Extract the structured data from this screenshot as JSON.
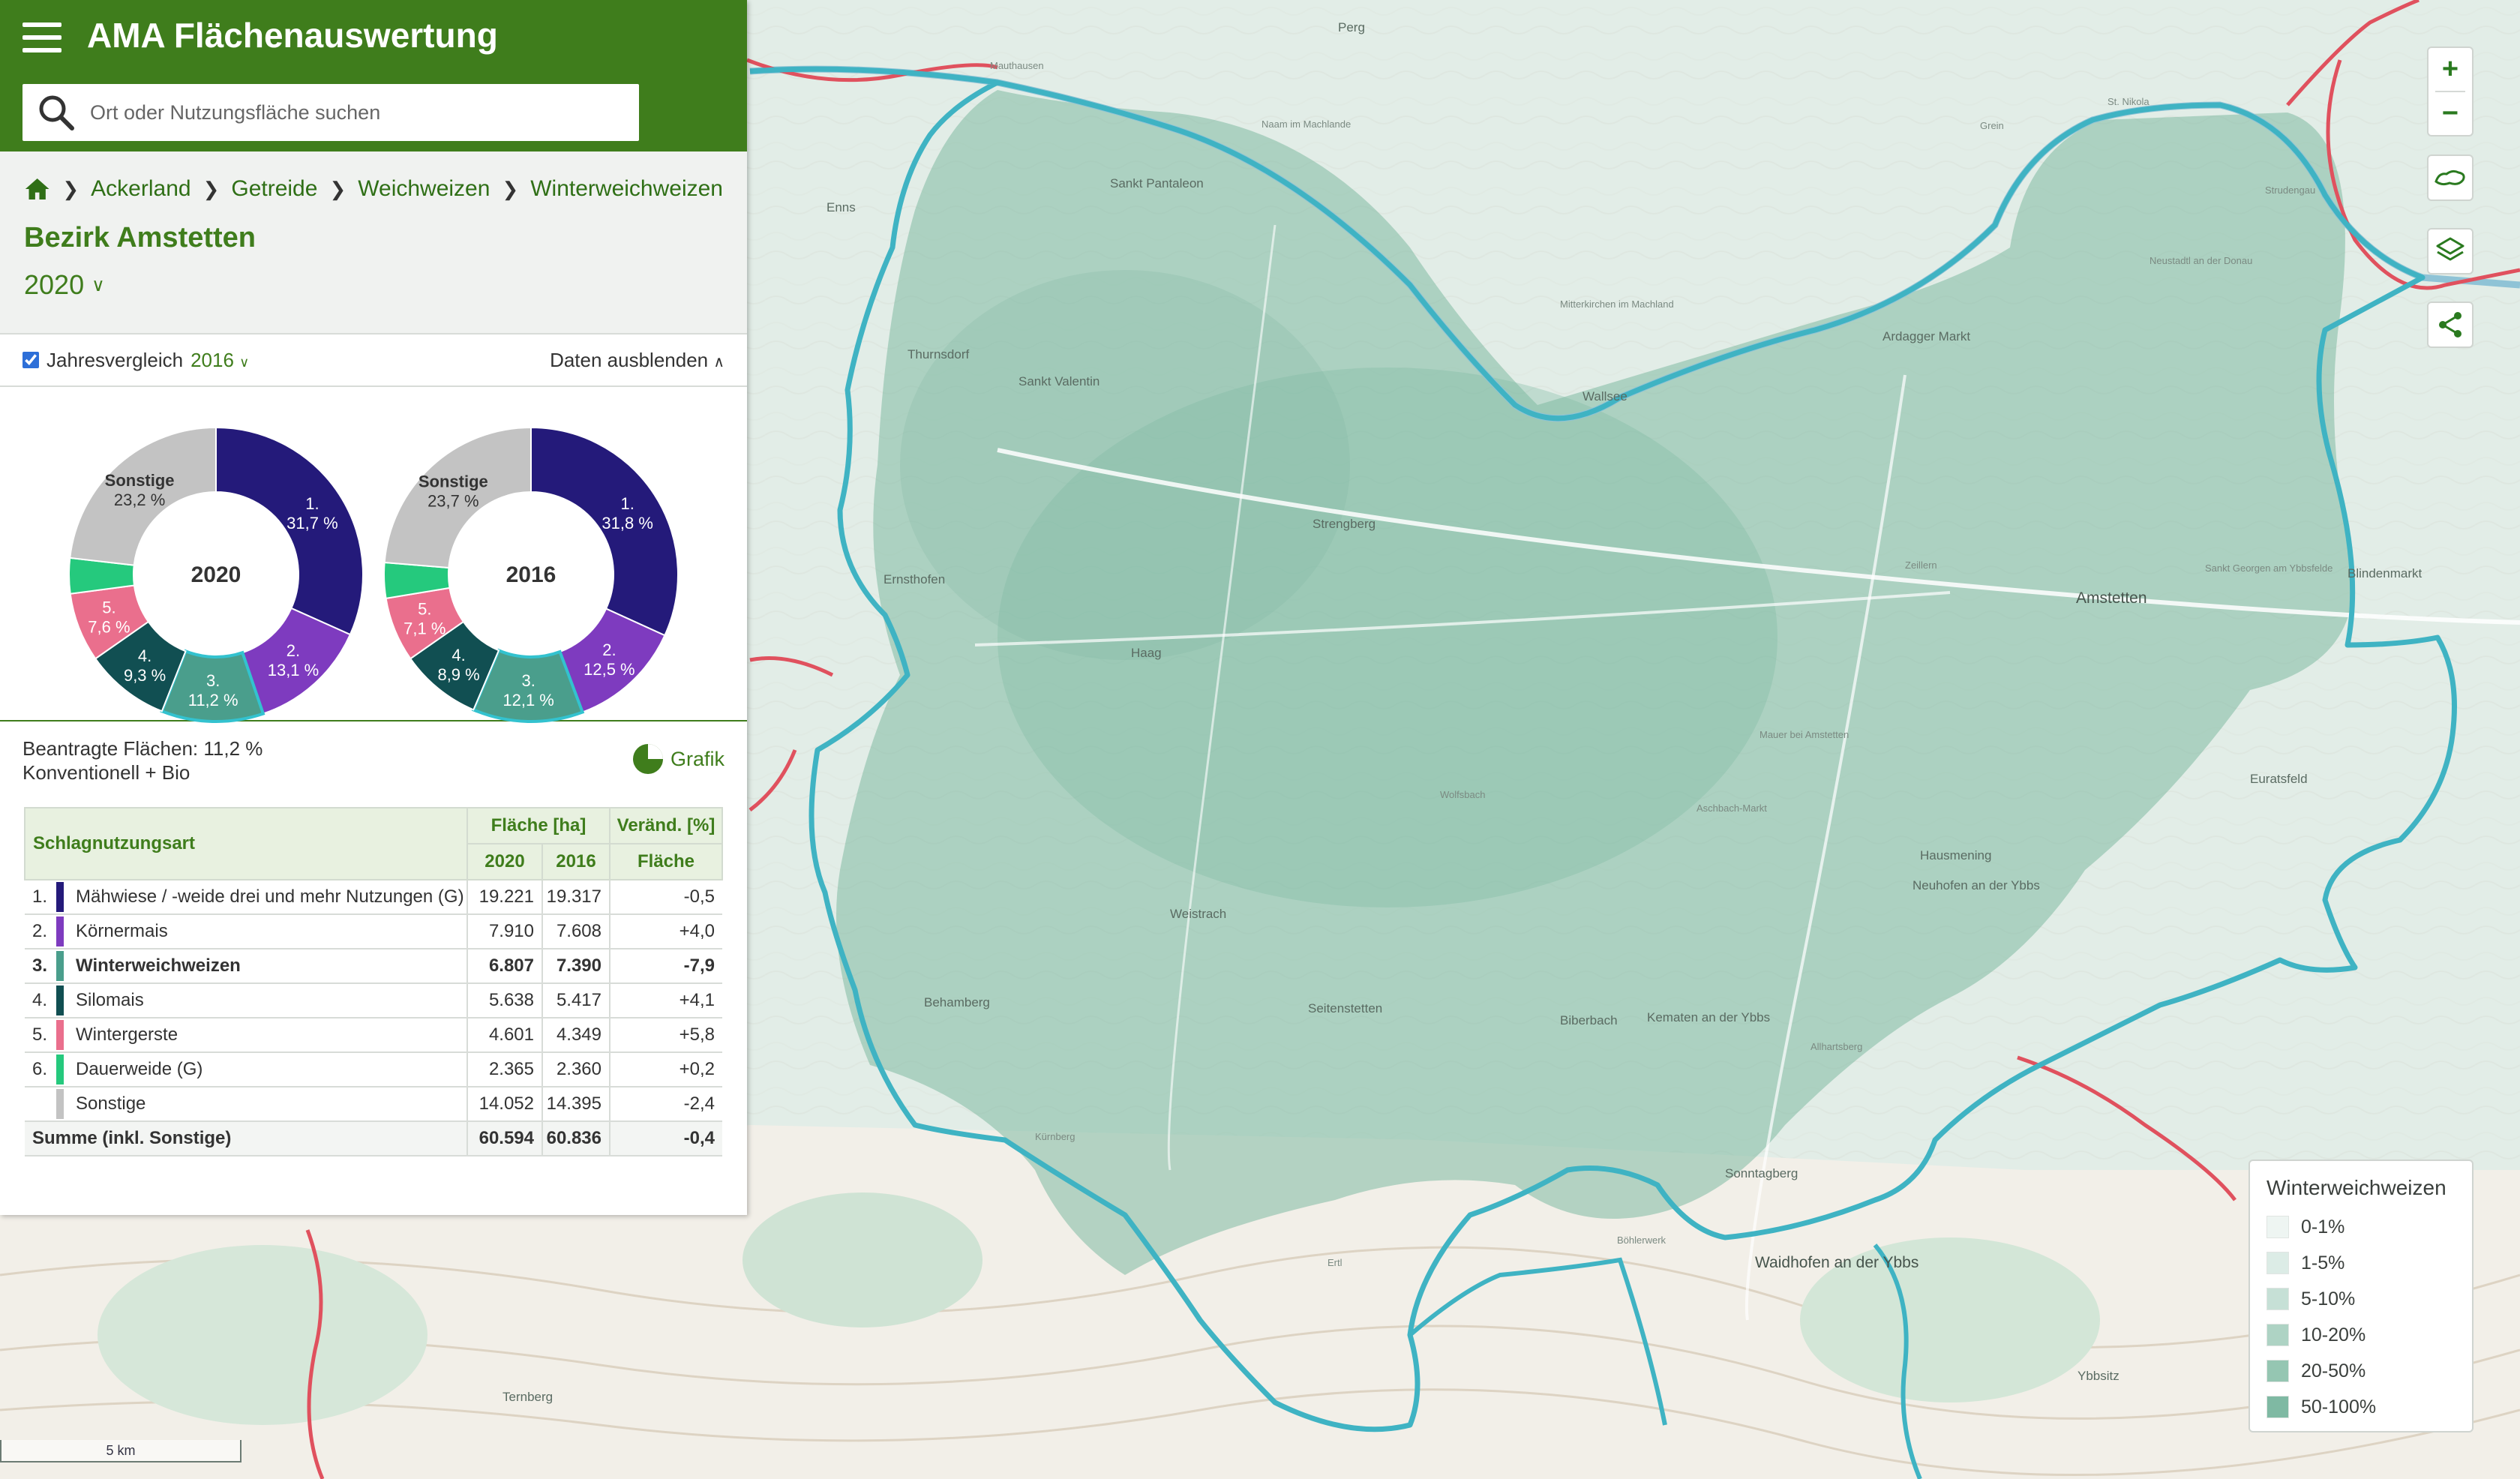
{
  "app": {
    "title": "AMA Flächenauswertung",
    "search_placeholder": "Ort oder Nutzungsfläche suchen"
  },
  "breadcrumb": [
    "Ackerland",
    "Getreide",
    "Weichweizen",
    "Winterweichweizen"
  ],
  "district": "Bezirk Amstetten",
  "year": "2020",
  "compare": {
    "label": "Jahresvergleich",
    "year": "2016",
    "checked": true,
    "hide_label": "Daten ausblenden"
  },
  "colors": {
    "green": "#3f7d1c",
    "rank1": "#241a7a",
    "rank2": "#7e3bbf",
    "rank3": "#4a9e8c",
    "rank4": "#114f52",
    "rank5": "#ea6f8d",
    "rank6": "#25c97d",
    "other": "#c3c3c3",
    "region_fill": "#7fb9a3",
    "border_teal": "#3fb3c3",
    "border_red": "#e0515e"
  },
  "chart_data": [
    {
      "type": "pie",
      "center_label": "2020",
      "labels": [
        "1.",
        "2.",
        "3.",
        "4.",
        "5.",
        "6.",
        "Sonstige"
      ],
      "values": [
        31.7,
        13.1,
        11.2,
        9.3,
        7.6,
        3.9,
        23.2
      ],
      "value_labels": [
        "31,7 %",
        "13,1 %",
        "11,2 %",
        "9,3 %",
        "7,6 %",
        "",
        "23,2 %"
      ]
    },
    {
      "type": "pie",
      "center_label": "2016",
      "labels": [
        "1.",
        "2.",
        "3.",
        "4.",
        "5.",
        "6.",
        "Sonstige"
      ],
      "values": [
        31.8,
        12.5,
        12.1,
        8.9,
        7.1,
        3.9,
        23.7
      ],
      "value_labels": [
        "31,8 %",
        "12,5 %",
        "12,1 %",
        "8,9 %",
        "7,1 %",
        "",
        "23,7 %"
      ]
    }
  ],
  "info": {
    "line1": "Beantragte Flächen: 11,2 %",
    "line2": "Konventionell + Bio",
    "grafik_label": "Grafik"
  },
  "table": {
    "col_type": "Schlagnutzungsart",
    "col_area": "Fläche [ha]",
    "col_change": "Veränd. [%]",
    "sub_2020": "2020",
    "sub_2016": "2016",
    "sub_area": "Fläche",
    "rows": [
      {
        "rank": "1.",
        "name": "Mähwiese / -weide drei und mehr Nutzungen (G)",
        "v2020": "19.221",
        "v2016": "19.317",
        "change": "-0,5",
        "color": "#241a7a",
        "bold": false
      },
      {
        "rank": "2.",
        "name": "Körnermais",
        "v2020": "7.910",
        "v2016": "7.608",
        "change": "+4,0",
        "color": "#7e3bbf",
        "bold": false
      },
      {
        "rank": "3.",
        "name": "Winterweichweizen",
        "v2020": "6.807",
        "v2016": "7.390",
        "change": "-7,9",
        "color": "#4a9e8c",
        "bold": true
      },
      {
        "rank": "4.",
        "name": "Silomais",
        "v2020": "5.638",
        "v2016": "5.417",
        "change": "+4,1",
        "color": "#114f52",
        "bold": false
      },
      {
        "rank": "5.",
        "name": "Wintergerste",
        "v2020": "4.601",
        "v2016": "4.349",
        "change": "+5,8",
        "color": "#ea6f8d",
        "bold": false
      },
      {
        "rank": "6.",
        "name": "Dauerweide (G)",
        "v2020": "2.365",
        "v2016": "2.360",
        "change": "+0,2",
        "color": "#25c97d",
        "bold": false
      },
      {
        "rank": "",
        "name": "Sonstige",
        "v2020": "14.052",
        "v2016": "14.395",
        "change": "-2,4",
        "color": "#c3c3c3",
        "bold": false
      }
    ],
    "sum": {
      "name": "Summe (inkl. Sonstige)",
      "v2020": "60.594",
      "v2016": "60.836",
      "change": "-0,4"
    }
  },
  "legend": {
    "title": "Winterweichweizen",
    "items": [
      {
        "label": "0-1%",
        "color": "#eef5f2"
      },
      {
        "label": "1-5%",
        "color": "#dcece6"
      },
      {
        "label": "5-10%",
        "color": "#c6e0d6"
      },
      {
        "label": "10-20%",
        "color": "#aed3c4"
      },
      {
        "label": "20-50%",
        "color": "#95c6b2"
      },
      {
        "label": "50-100%",
        "color": "#7fb9a3"
      }
    ]
  },
  "map": {
    "scale_label": "5 km",
    "places": [
      {
        "name": "Perg",
        "size": "med"
      },
      {
        "name": "Mauthausen",
        "size": "sm"
      },
      {
        "name": "Naam im Machlande",
        "size": "sm"
      },
      {
        "name": "Sankt Pantaleon",
        "size": "med"
      },
      {
        "name": "Enns",
        "size": "med"
      },
      {
        "name": "Mitterkirchen im Machland",
        "size": "sm"
      },
      {
        "name": "Ardagger Markt",
        "size": "med"
      },
      {
        "name": "Thurnsdorf",
        "size": "med"
      },
      {
        "name": "Sankt Valentin",
        "size": "med"
      },
      {
        "name": "Wallsee",
        "size": "med"
      },
      {
        "name": "Strengberg",
        "size": "med"
      },
      {
        "name": "Ernsthofen",
        "size": "med"
      },
      {
        "name": "Amstetten",
        "size": "big"
      },
      {
        "name": "Zeillern",
        "size": "sm"
      },
      {
        "name": "Haag",
        "size": "med"
      },
      {
        "name": "Blindenmarkt",
        "size": "med"
      },
      {
        "name": "Euratsfeld",
        "size": "med"
      },
      {
        "name": "Hausmening",
        "size": "med"
      },
      {
        "name": "Neuhofen an der Ybbs",
        "size": "med"
      },
      {
        "name": "Weistrach",
        "size": "med"
      },
      {
        "name": "Behamberg",
        "size": "med"
      },
      {
        "name": "Seitenstetten",
        "size": "med"
      },
      {
        "name": "Biberbach",
        "size": "med"
      },
      {
        "name": "Kematen an der Ybbs",
        "size": "med"
      },
      {
        "name": "Aschbach-Markt",
        "size": "sm"
      },
      {
        "name": "Mauer bei Amstetten",
        "size": "sm"
      },
      {
        "name": "Wolfsbach",
        "size": "sm"
      },
      {
        "name": "Sonntagberg",
        "size": "med"
      },
      {
        "name": "Waidhofen an der Ybbs",
        "size": "big"
      },
      {
        "name": "Ybbsitz",
        "size": "med"
      },
      {
        "name": "Neustadtl an der Donau",
        "size": "sm"
      },
      {
        "name": "Strudengau",
        "size": "sm"
      },
      {
        "name": "Sankt Georgen am Ybbsfelde",
        "size": "sm"
      },
      {
        "name": "Ternberg",
        "size": "med"
      },
      {
        "name": "Kürnberg",
        "size": "sm"
      },
      {
        "name": "St. Nikola",
        "size": "sm"
      },
      {
        "name": "Grein",
        "size": "sm"
      },
      {
        "name": "Ertl",
        "size": "sm"
      },
      {
        "name": "Allhartsberg",
        "size": "sm"
      },
      {
        "name": "Böhlerwerk",
        "size": "sm"
      }
    ]
  }
}
